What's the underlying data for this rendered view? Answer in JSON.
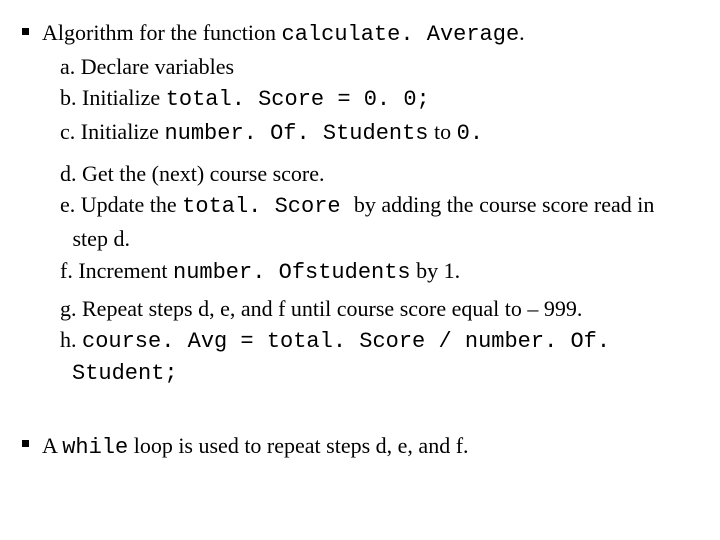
{
  "bullet1": {
    "prefix": " Algorithm for the function ",
    "code": "calculate. Average",
    "suffix": "."
  },
  "items": {
    "a": "a. Declare variables",
    "b": {
      "prefix": "b. Initialize  ",
      "code": "total. Score = 0. 0;"
    },
    "c": {
      "prefix": "c. Initialize ",
      "code": "number. Of. Students",
      "mid": " to ",
      "code2": "0."
    },
    "d": "d. Get the (next) course score.",
    "e": {
      "prefix": "e. Update the ",
      "code": "total. Score ",
      "mid": " by adding the course score read in",
      "cont": "step d."
    },
    "f": {
      "prefix": "f. Increment ",
      "code": "number. Ofstudents",
      "suffix": " by 1."
    },
    "g": "g. Repeat steps d, e, and f until course score equal to – 999.",
    "h": {
      "prefix": "h. ",
      "code": "course. Avg = total. Score / number. Of. Student;"
    }
  },
  "bullet2": {
    "prefix": " A ",
    "code": "while",
    "suffix": " loop is used to repeat steps d, e, and f."
  }
}
